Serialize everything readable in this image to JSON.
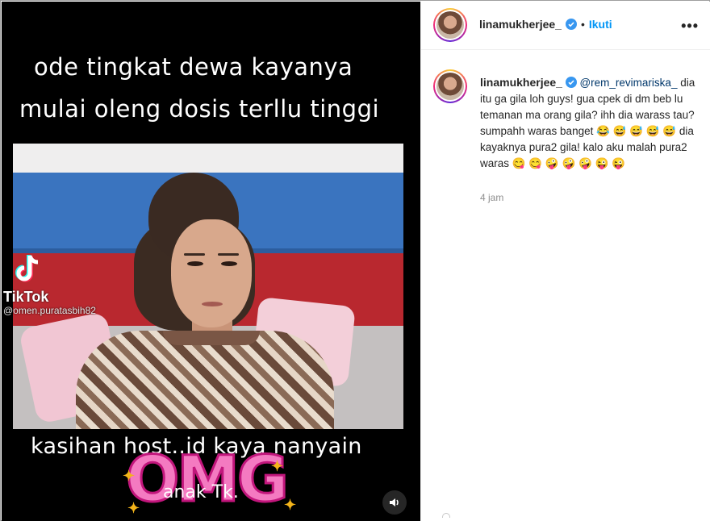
{
  "media": {
    "caption_top_line1": "ode tingkat dewa kayanya",
    "caption_top_line2": "mulai oleng dosis terllu tinggi",
    "caption_bottom": "kasihan host..jd kaya nanyain",
    "omg_text": "OMG",
    "caption_bottom2": "anak Tk.",
    "watermark": {
      "brand": "TikTok",
      "handle": "@omen.puratasbih82"
    }
  },
  "post": {
    "header": {
      "username": "linamukherjee_",
      "separator": "•",
      "follow_label": "Ikuti",
      "more_label": "•••"
    },
    "comment": {
      "username": "linamukherjee_",
      "mention": "@rem_revimariska_",
      "text": " dia itu ga gila loh guys! gua cpek di dm beb lu temanan ma orang gila? ihh dia warass tau? sumpahh waras banget 😂 😅 😅 😅 😅 dia kayaknya pura2 gila! kalo aku malah pura2 waras 😋 😋 🤪 🤪 🤪 😜 😜",
      "time": "4 jam"
    }
  },
  "colors": {
    "accent": "#0095f6",
    "mention": "#00376b",
    "muted": "#8e8e8e",
    "verified": "#3897f0"
  },
  "icons": [
    "tiktok-logo-icon",
    "verified-badge-icon",
    "more-options-icon",
    "sound-icon"
  ]
}
